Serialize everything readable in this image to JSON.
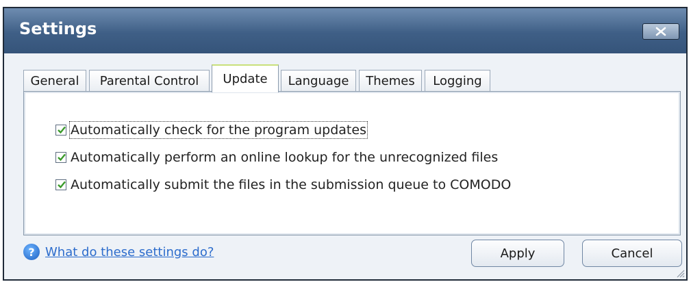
{
  "window": {
    "title": "Settings"
  },
  "tabs": [
    {
      "label": "General",
      "active": false
    },
    {
      "label": "Parental Control",
      "active": false
    },
    {
      "label": "Update",
      "active": true
    },
    {
      "label": "Language",
      "active": false
    },
    {
      "label": "Themes",
      "active": false
    },
    {
      "label": "Logging",
      "active": false
    }
  ],
  "options": [
    {
      "label": "Automatically check for the program updates",
      "checked": true
    },
    {
      "label": "Automatically perform an online lookup for the unrecognized files",
      "checked": true
    },
    {
      "label": "Automatically submit the files in the submission queue to COMODO",
      "checked": true
    }
  ],
  "help": {
    "icon": "help-icon",
    "link_text": "What do these settings do?"
  },
  "buttons": {
    "apply": "Apply",
    "cancel": "Cancel"
  },
  "colors": {
    "titlebar": "#3f5f86",
    "check": "#3a9a2a",
    "link": "#2c6ccc"
  }
}
